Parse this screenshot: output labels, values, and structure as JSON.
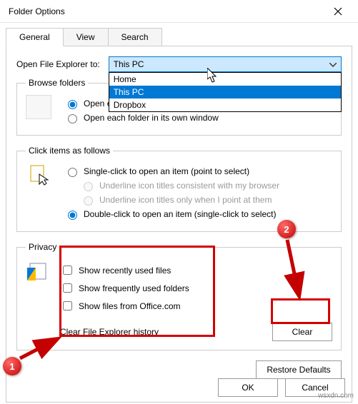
{
  "window": {
    "title": "Folder Options"
  },
  "tabs": [
    "General",
    "View",
    "Search"
  ],
  "open_in": {
    "label": "Open File Explorer to:",
    "value": "This PC",
    "options": [
      "Home",
      "This PC",
      "Dropbox"
    ]
  },
  "browse": {
    "legend": "Browse folders",
    "opt_same": "Open eac",
    "opt_own": "Open each folder in its own window"
  },
  "click": {
    "legend": "Click items as follows",
    "single": "Single-click to open an item (point to select)",
    "underline_browser": "Underline icon titles consistent with my browser",
    "underline_point": "Underline icon titles only when I point at them",
    "double": "Double-click to open an item (single-click to select)"
  },
  "privacy": {
    "legend": "Privacy",
    "show_recent": "Show recently used files",
    "show_freq": "Show frequently used folders",
    "show_office": "Show files from Office.com",
    "clear_label": "Clear File Explorer history",
    "clear_btn": "Clear"
  },
  "buttons": {
    "restore": "Restore Defaults",
    "ok": "OK",
    "cancel": "Cancel"
  },
  "annotations": {
    "badge1": "1",
    "badge2": "2"
  },
  "watermark": "wsxdn.com"
}
